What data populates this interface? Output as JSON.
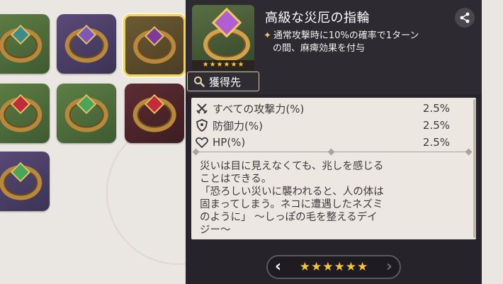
{
  "item": {
    "title": "高級な災厄の指輪",
    "passive_bullet": "✦",
    "passive_line1": "通常攻撃時に10%の確率で1ターン",
    "passive_line2": "の間、麻痺効果を付与",
    "stars": 6,
    "star_glyph": "★"
  },
  "acquire": {
    "label": "獲得先",
    "icon": "magnifier-icon"
  },
  "stats": [
    {
      "icon": "crossed-swords-icon",
      "name": "すべての攻撃力(%)",
      "value": "2.5%"
    },
    {
      "icon": "shield-icon",
      "name": "防御力(%)",
      "value": "2.5%"
    },
    {
      "icon": "heart-icon",
      "name": "HP(%)",
      "value": "2.5%"
    }
  ],
  "flavor": {
    "line1": "災いは目に見えなくても、兆しを感じる",
    "line2": "ことはできる。",
    "line3": "「恐ろしい災いに襲われると、人の体は",
    "line4": "固まってしまう。ネコに遭遇したネズミ",
    "line5": "のように」 〜しっぽの毛を整えるデイ",
    "line6": "ジー〜"
  },
  "nav": {
    "prev_glyph": "‹",
    "next_glyph": "›",
    "star_glyph": "★",
    "stars": 6
  },
  "inventory": [
    {
      "bg": "green",
      "gem": "teal"
    },
    {
      "bg": "purple",
      "gem": "purple"
    },
    {
      "bg": "gold",
      "gem": "violet",
      "selected": true
    },
    {
      "bg": "green",
      "gem": "red"
    },
    {
      "bg": "green",
      "gem": "green"
    },
    {
      "bg": "red",
      "gem": "red"
    },
    {
      "bg": "purple",
      "gem": "green"
    }
  ],
  "colors": {
    "star": "#f4c534",
    "panel": "#26242a",
    "sheet": "#ece8e1",
    "selected_border": "#f2cf62"
  }
}
